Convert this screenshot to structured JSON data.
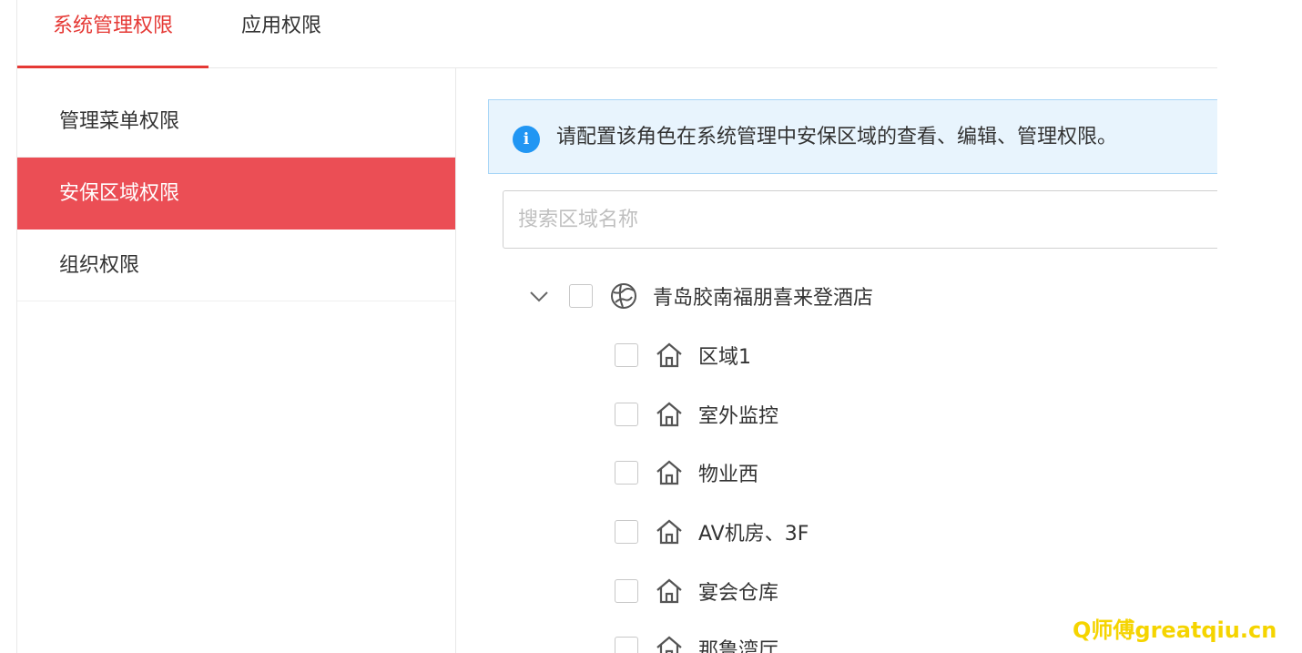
{
  "tabs": [
    {
      "label": "系统管理权限",
      "active": true
    },
    {
      "label": "应用权限",
      "active": false
    }
  ],
  "sidebar": {
    "items": [
      {
        "label": "管理菜单权限",
        "active": false
      },
      {
        "label": "安保区域权限",
        "active": true
      },
      {
        "label": "组织权限",
        "active": false
      }
    ]
  },
  "alert": {
    "icon": "info-icon",
    "icon_glyph": "i",
    "text": "请配置该角色在系统管理中安保区域的查看、编辑、管理权限。"
  },
  "search": {
    "placeholder": "搜索区域名称",
    "value": ""
  },
  "tree": {
    "root": {
      "label": "青岛胶南福朋喜来登酒店",
      "icon": "globe-icon",
      "expanded": true,
      "checked": false
    },
    "children": [
      {
        "label": "区域1",
        "icon": "home-icon",
        "checked": false
      },
      {
        "label": "室外监控",
        "icon": "home-icon",
        "checked": false
      },
      {
        "label": "物业西",
        "icon": "home-icon",
        "checked": false
      },
      {
        "label": "AV机房、3F",
        "icon": "home-icon",
        "checked": false
      },
      {
        "label": "宴会仓库",
        "icon": "home-icon",
        "checked": false
      },
      {
        "label": "那鲁湾厅",
        "icon": "home-icon",
        "checked": false
      }
    ]
  },
  "watermark": "Q师傅greatqiu.cn",
  "colors": {
    "accent": "#e53935",
    "sidebar_active_bg": "#eb4e55",
    "alert_bg": "#e8f4fd",
    "alert_border": "#a8d6f7",
    "info_icon": "#2196f3",
    "watermark": "#f5d400"
  }
}
